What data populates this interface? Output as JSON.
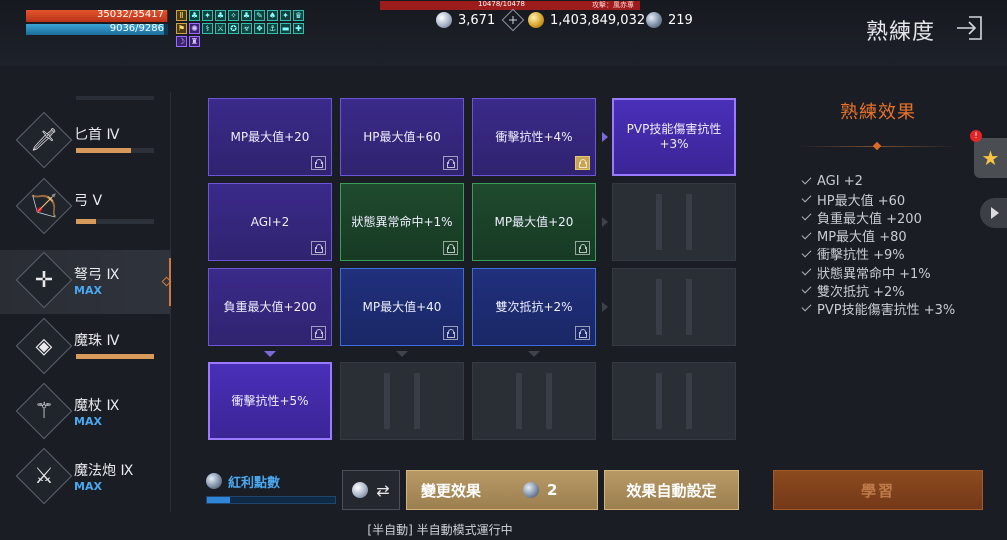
{
  "player": {
    "hp": "35032/35417",
    "hp_fraction": 0.99,
    "mp": "9036/9286",
    "mp_fraction": 0.975
  },
  "target": {
    "hp": "10478/10478",
    "name": "攻擊：風赤蓴"
  },
  "currency": {
    "diamond": "3,671",
    "gold": "1,403,849,032",
    "orb": "219"
  },
  "header": {
    "title": "熟練度"
  },
  "weapons": [
    {
      "name": "匕首 Ⅳ",
      "icon": "dagger-icon",
      "glyph": "🗡",
      "max": "",
      "progress": 0.7
    },
    {
      "name": "弓 Ⅴ",
      "icon": "bow-icon",
      "glyph": "🏹",
      "max": "",
      "progress": 0.25
    },
    {
      "name": "弩弓 Ⅸ",
      "icon": "crossbow-icon",
      "glyph": "✛",
      "max": "MAX",
      "progress": null,
      "selected": true
    },
    {
      "name": "魔珠 Ⅳ",
      "icon": "orb-icon",
      "glyph": "◈",
      "max": "",
      "progress": 1.0
    },
    {
      "name": "魔杖 Ⅸ",
      "icon": "staff-icon",
      "glyph": "⚚",
      "max": "MAX",
      "progress": null
    },
    {
      "name": "魔法炮 Ⅸ",
      "icon": "cannon-icon",
      "glyph": "⚔",
      "max": "MAX",
      "progress": null
    }
  ],
  "grid": {
    "r1c1": "MP最大值+20",
    "r1c2": "HP最大值+60",
    "r1c3": "衝擊抗性+4%",
    "r1c4": "PVP技能傷害抗性\n+3%",
    "r2c1": "AGI+2",
    "r2c2": "狀態異常命中+1%",
    "r2c3": "MP最大值+20",
    "r3c1": "負重最大值+200",
    "r3c2": "MP最大值+40",
    "r3c3": "雙次抵抗+2%",
    "r4c1": "衝擊抗性+5%"
  },
  "effects": {
    "title": "熟練效果",
    "items": [
      "AGI +2",
      "HP最大值 +60",
      "負重最大值 +200",
      "MP最大值 +80",
      "衝擊抗性 +9%",
      "狀態異常命中 +1%",
      "雙次抵抗 +2%",
      "PVP技能傷害抗性 +3%"
    ]
  },
  "bottom": {
    "bonus_label": "紅利點數",
    "bonus_progress": 0.18,
    "change_effect": "變更效果",
    "change_cost": "2",
    "auto_set": "效果自動設定",
    "learn": "學習",
    "status": "[半自動] 半自動模式運行中"
  },
  "colors": {
    "accent": "#e8722c",
    "max_blue": "#4aa8f0",
    "tile_purple": "#3a2a8a",
    "tile_green": "#1f4a2e",
    "tile_blue": "#20307c"
  }
}
